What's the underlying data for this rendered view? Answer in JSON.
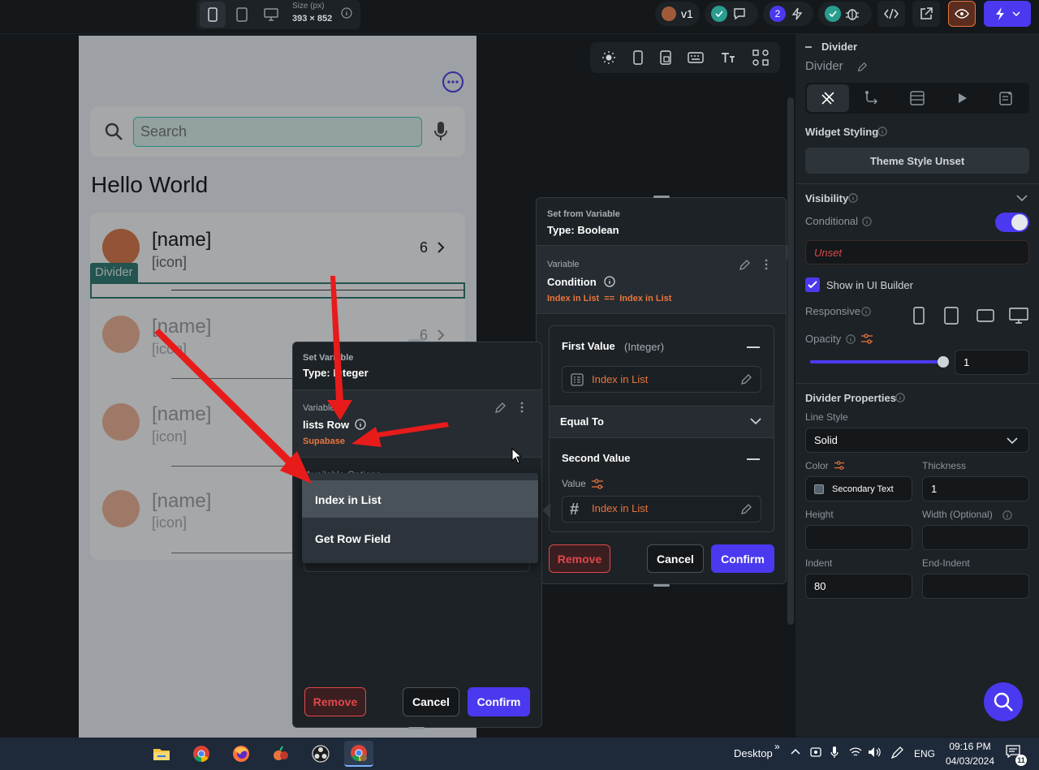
{
  "topbar": {
    "size_label": "Size (px)",
    "size_value": "393 × 852",
    "version_label": "v1",
    "badge_count": "2"
  },
  "phone": {
    "search_placeholder": "Search",
    "heading": "Hello World",
    "rows": [
      {
        "name": "[name]",
        "icon": "[icon]",
        "count": "6"
      },
      {
        "name": "[name]",
        "icon": "[icon]",
        "count": "6"
      },
      {
        "name": "[name]",
        "icon": "[icon]"
      },
      {
        "name": "[name]",
        "icon": "[icon]"
      }
    ],
    "divider_tag": "Divider"
  },
  "set_variable": {
    "header_small": "Set Variable",
    "header_type": "Type: Integer",
    "variable_label": "Variable",
    "variable_name": "lists Row",
    "variable_source": "Supabase",
    "available_options": "Available Options",
    "options": [
      "Index in List",
      "Get Row Field"
    ],
    "remove": "Remove",
    "cancel": "Cancel",
    "confirm": "Confirm"
  },
  "set_from_variable": {
    "header_small": "Set from Variable",
    "header_type": "Type: Boolean",
    "variable_label": "Variable",
    "condition_label": "Condition",
    "condition_expr": "Index in List  ==  Index in List",
    "first_value_label": "First Value",
    "first_value_type": "(Integer)",
    "first_value": "Index in List",
    "equal_to": "Equal To",
    "second_value_label": "Second Value",
    "value_label": "Value",
    "second_value": "Index in List",
    "remove": "Remove",
    "cancel": "Cancel",
    "confirm": "Confirm"
  },
  "right_panel": {
    "section_title": "Divider",
    "widget_name": "Divider",
    "widget_styling": "Widget Styling",
    "theme_style": "Theme Style Unset",
    "visibility": "Visibility",
    "conditional": "Conditional",
    "unset": "Unset",
    "show_in_ui_builder": "Show in UI Builder",
    "responsive": "Responsive",
    "opacity": "Opacity",
    "opacity_value": "1",
    "opacity_level": 1,
    "divider_properties": "Divider Properties",
    "line_style_label": "Line Style",
    "line_style_value": "Solid",
    "color_label": "Color",
    "color_value": "Secondary Text",
    "thickness_label": "Thickness",
    "thickness_value": "1",
    "height_label": "Height",
    "width_label": "Width (Optional)",
    "indent_label": "Indent",
    "indent_value": "80",
    "end_indent_label": "End-Indent"
  },
  "taskbar": {
    "desktop_label": "Desktop",
    "lang": "ENG",
    "time": "09:16 PM",
    "date": "04/03/2024",
    "notification_count": "11"
  },
  "colors": {
    "accent": "#4b39ef",
    "teal": "#39d2c0",
    "orange": "#e9753e",
    "remove_red": "#e0484b",
    "arrow_red": "#e81b1b"
  }
}
